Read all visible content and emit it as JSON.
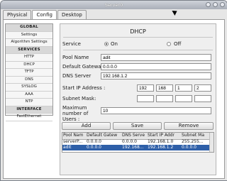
{
  "window": {
    "title": "Server0"
  },
  "tabs": [
    "Physical",
    "Config",
    "Desktop"
  ],
  "sidebar": {
    "items": [
      {
        "label": "GLOBAL",
        "header": true
      },
      {
        "label": "Settings"
      },
      {
        "label": "Algorithm Settings"
      },
      {
        "label": "SERVICES",
        "header": true
      },
      {
        "label": "HTTP"
      },
      {
        "label": "DHCP"
      },
      {
        "label": "TFTP"
      },
      {
        "label": "DNS"
      },
      {
        "label": "SYSLOG"
      },
      {
        "label": "AAA"
      },
      {
        "label": "NTP"
      },
      {
        "label": "INTERFACE",
        "header": true
      },
      {
        "label": "FastEthernet"
      }
    ]
  },
  "dhcp": {
    "title": "DHCP",
    "service_label": "Service",
    "on_label": "On",
    "off_label": "Off",
    "pool_name_label": "Pool Name",
    "pool_name_value": "adit",
    "gateway_label": "Default Gateway",
    "gateway_value": "0.0.0.0",
    "dns_label": "DNS Server",
    "dns_value": "192.168.1.2",
    "start_ip_label": "Start IP Address :",
    "start_ip": [
      "192",
      "168",
      "1",
      "2"
    ],
    "subnet_label": "Subnet Mask:",
    "max_users_label": "Maximum number of Users :",
    "max_users_value": "10",
    "add_label": "Add",
    "save_label": "Save",
    "remove_label": "Remove",
    "table": {
      "columns": [
        "Pool Nam",
        "Default Gatew",
        "DNS Serve",
        "Start IP Addr",
        "Subnet Ma"
      ],
      "rows": [
        [
          "serverP...",
          "0.0.0.0",
          "0.0.0.0",
          "192.168.1.0",
          "255.255..."
        ],
        [
          "adit",
          "0.0.0.0",
          "192.168...",
          "192.168.1.2",
          "0.0.0.0"
        ]
      ]
    }
  }
}
